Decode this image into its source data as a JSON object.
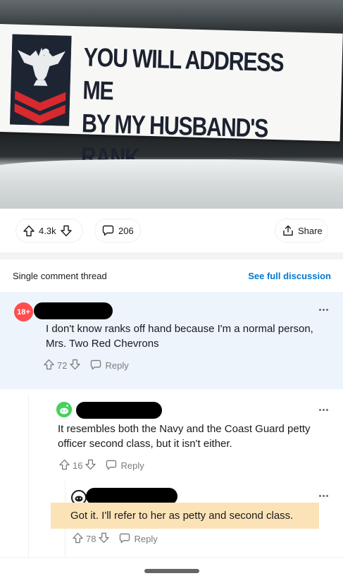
{
  "post": {
    "sticker_text": "YOU WILL ADDRESS ME\nBY MY HUSBAND'S RANK",
    "upvotes": "4.3k",
    "comments": "206",
    "share_label": "Share"
  },
  "thread": {
    "title": "Single comment thread",
    "see_full": "See full discussion"
  },
  "comments": [
    {
      "avatar_badge": "18+",
      "text": "I don't know ranks off hand because I'm a normal person, Mrs. Two Red Chevrons",
      "votes": "72",
      "reply_label": "Reply"
    },
    {
      "text": "It resembles both the Navy and the Coast Guard petty officer second class, but it isn't either.",
      "votes": "16",
      "reply_label": "Reply"
    },
    {
      "text": "Got it. I'll refer to her as petty and second class.",
      "votes": "78",
      "reply_label": "Reply"
    }
  ],
  "colors": {
    "accent": "#0079d3",
    "badge": "#ff4d4f",
    "highlight_bg": "#edf4fc",
    "quote_highlight": "#fbe3b7",
    "chevron_red": "#d72a2f",
    "insignia_navy": "#1d2533"
  },
  "icons": {
    "upvote": "arrow-up-icon",
    "downvote": "arrow-down-icon",
    "comment": "speech-bubble-icon",
    "share": "share-icon",
    "more": "more-dots-icon"
  }
}
